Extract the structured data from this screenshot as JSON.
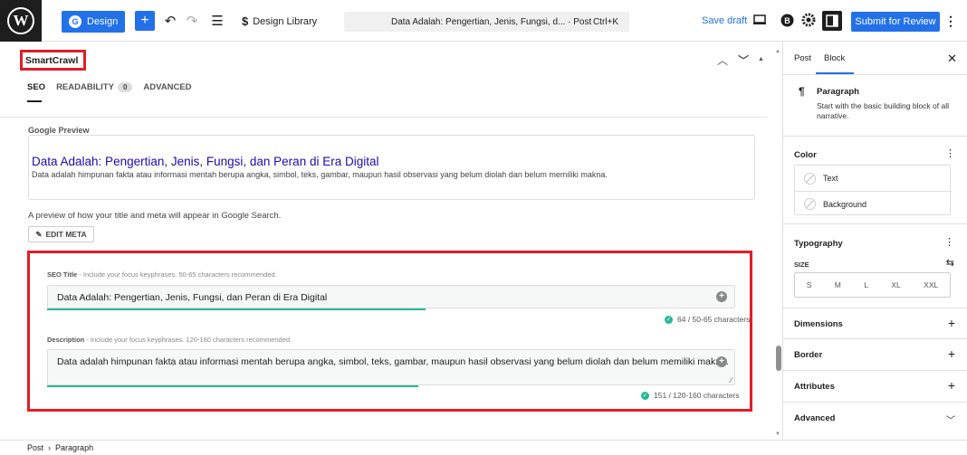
{
  "topbar": {
    "design_label": "Design",
    "design_library_label": "Design Library",
    "command_title": "Data Adalah: Pengertian, Jenis, Fungsi, d... · Post",
    "command_shortcut": "Ctrl+K",
    "save_draft_label": "Save draft",
    "submit_label": "Submit for Review"
  },
  "plugin": {
    "title": "SmartCrawl",
    "tabs": [
      {
        "label": "SEO"
      },
      {
        "label": "READABILITY",
        "badge": "0"
      },
      {
        "label": "ADVANCED"
      }
    ],
    "google_preview_label": "Google Preview",
    "preview_title": "Data Adalah: Pengertian, Jenis, Fungsi, dan Peran di Era Digital",
    "preview_desc": "Data adalah himpunan fakta atau informasi mentah berupa angka, simbol, teks, gambar, maupun hasil observasi yang belum diolah dan belum memiliki makna.",
    "preview_note": "A preview of how your title and meta will appear in Google Search.",
    "edit_meta_label": "EDIT META",
    "seo_title": {
      "label": "SEO Title",
      "hint": " - Include your focus keyphrases. 50-65 characters recommended.",
      "value": "Data Adalah: Pengertian, Jenis, Fungsi, dan Peran di Era Digital",
      "count": "64 / 50-65 characters",
      "progress": 0.55
    },
    "description": {
      "label": "Description",
      "hint": " - Include your focus keyphrases. 120-160 characters recommended.",
      "value": "Data adalah himpunan fakta atau informasi mentah berupa angka, simbol, teks, gambar, maupun hasil observasi yang belum diolah dan belum memiliki makna.",
      "count": "151 / 120-160 characters",
      "progress": 0.54
    }
  },
  "sidebar": {
    "tab_post": "Post",
    "tab_block": "Block",
    "block_title": "Paragraph",
    "block_desc": "Start with the basic building block of all narrative.",
    "color_title": "Color",
    "color_items": [
      "Text",
      "Background"
    ],
    "typography_title": "Typography",
    "size_label": "SIZE",
    "sizes": [
      "S",
      "M",
      "L",
      "XL",
      "XXL"
    ],
    "dimensions_title": "Dimensions",
    "border_title": "Border",
    "attributes_title": "Attributes",
    "advanced_title": "Advanced"
  },
  "breadcrumb": {
    "post": "Post",
    "sep": "›",
    "paragraph": "Paragraph"
  },
  "colors": {
    "accent": "#2271e8",
    "highlight": "#e11d28",
    "success": "#26b896",
    "link": "#1a0dab"
  }
}
